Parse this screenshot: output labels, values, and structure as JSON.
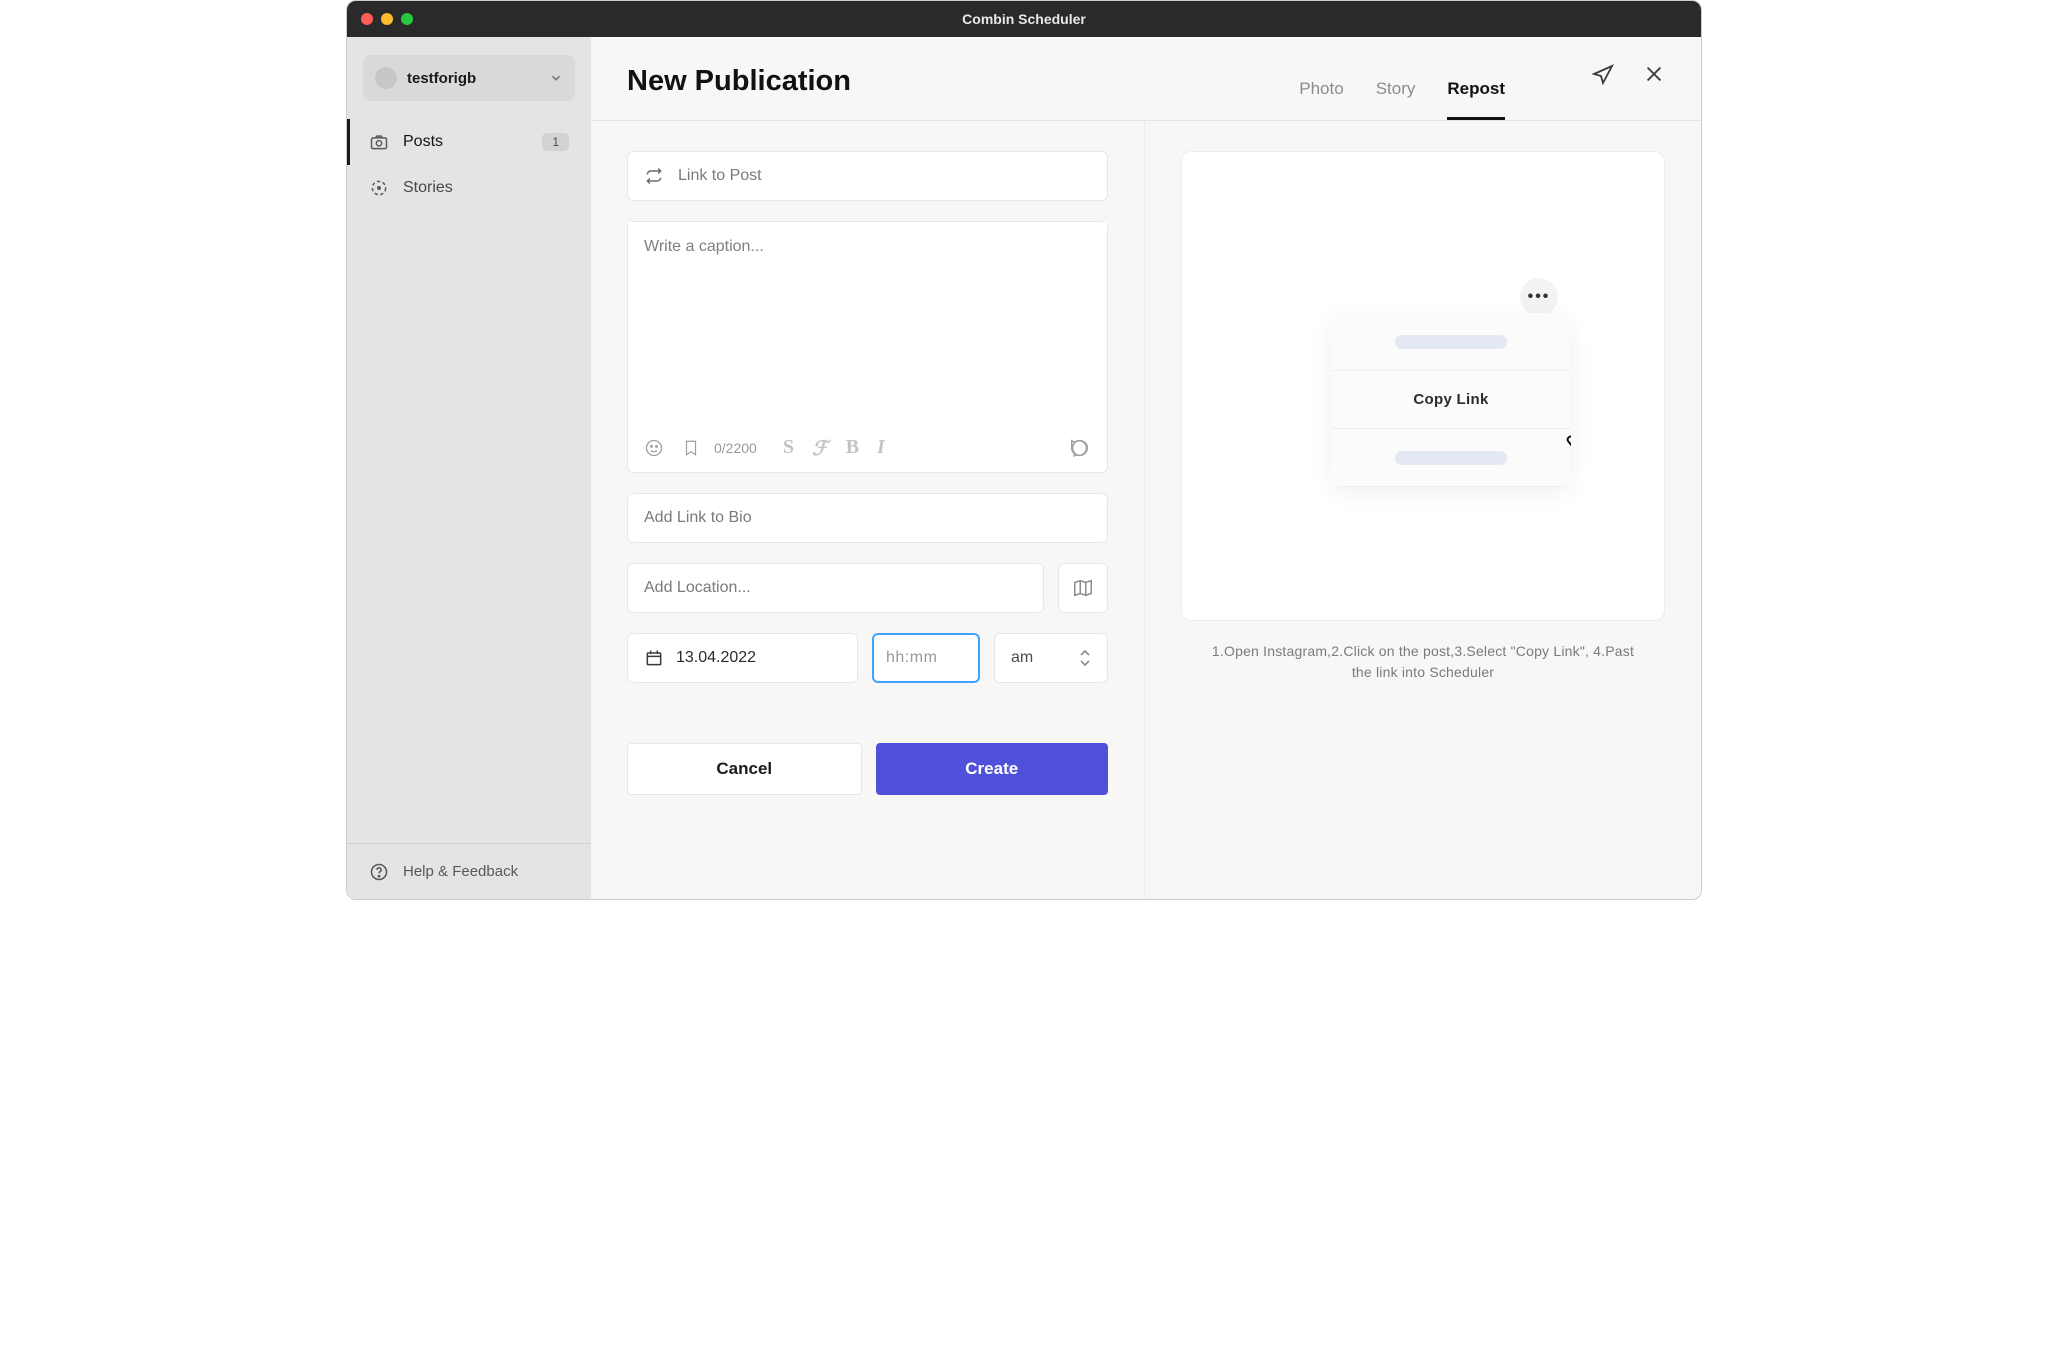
{
  "window": {
    "title": "Combin Scheduler"
  },
  "sidebar": {
    "account": "testforigb",
    "items": [
      {
        "label": "Posts",
        "badge": "1",
        "active": true
      },
      {
        "label": "Stories",
        "badge": null,
        "active": false
      }
    ],
    "footer": "Help & Feedback"
  },
  "header": {
    "title": "New Publication",
    "tabs": [
      {
        "label": "Photo",
        "active": false
      },
      {
        "label": "Story",
        "active": false
      },
      {
        "label": "Repost",
        "active": true
      }
    ]
  },
  "form": {
    "link_placeholder": "Link to Post",
    "caption_placeholder": "Write a caption...",
    "char_counter": "0/2200",
    "bio_placeholder": "Add Link to Bio",
    "location_placeholder": "Add Location...",
    "date_value": "13.04.2022",
    "time_placeholder": "hh:mm",
    "ampm": "am",
    "cancel": "Cancel",
    "create": "Create"
  },
  "preview": {
    "menu_label": "Copy Link",
    "instructions": "1.Open Instagram,2.Click on the post,3.Select \"Copy Link\", 4.Past the link into Scheduler"
  }
}
